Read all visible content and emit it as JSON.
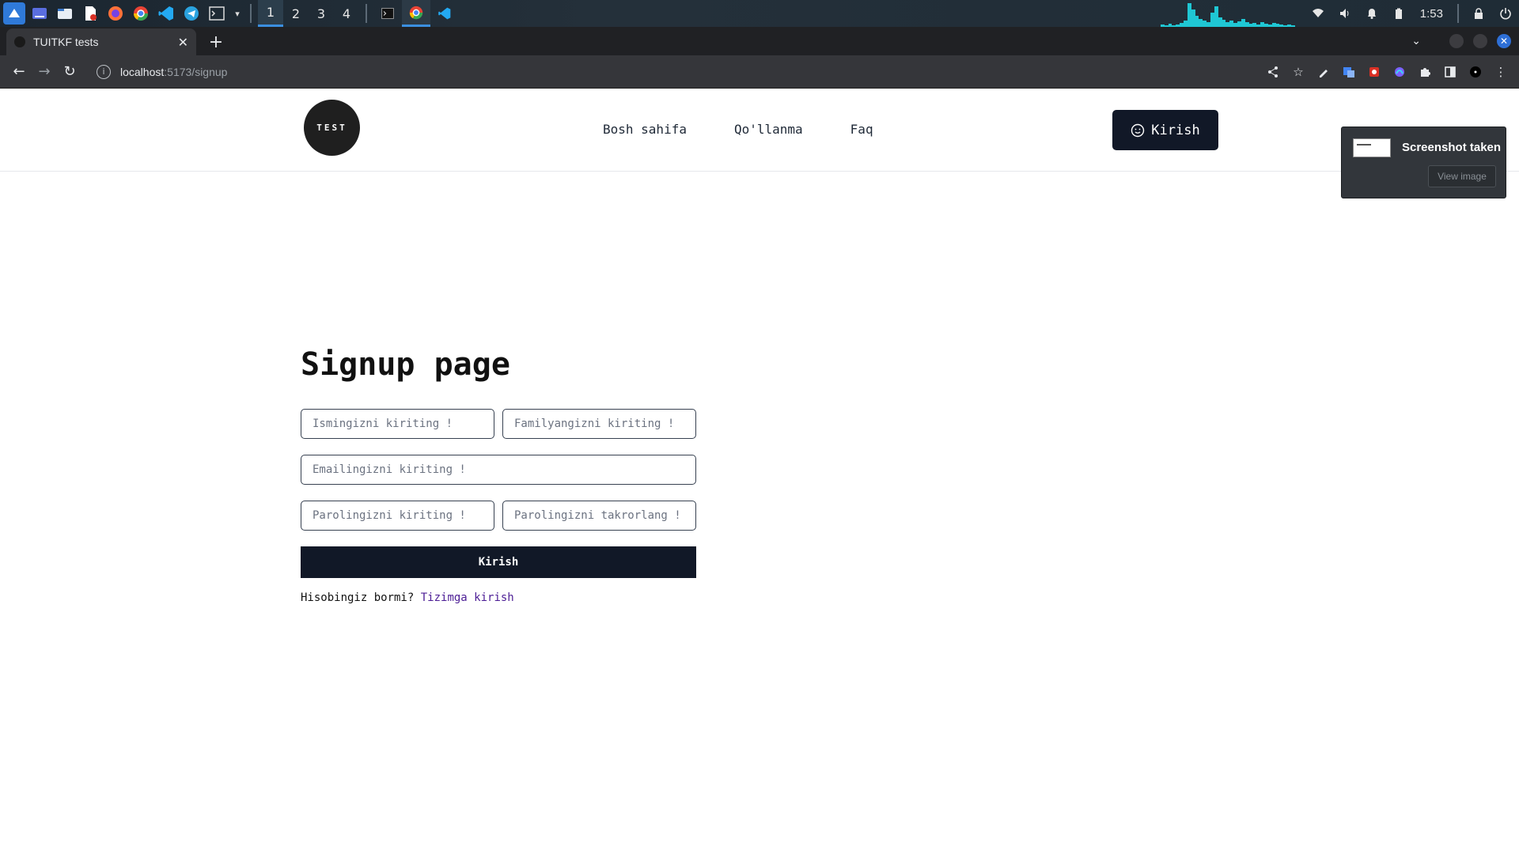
{
  "taskbar": {
    "apps": [
      {
        "icon": "launcher-icon",
        "color": "#2f7ad9"
      },
      {
        "icon": "desktop-icon",
        "color": "#5a6ee0"
      },
      {
        "icon": "files-icon",
        "color": "#e8eef5"
      },
      {
        "icon": "document-icon",
        "color": "#ffffff"
      },
      {
        "icon": "firefox-icon",
        "color": "#ff7139"
      },
      {
        "icon": "chrome-icon",
        "color": "#34a853"
      },
      {
        "icon": "vscode-icon",
        "color": "#23a9f2"
      },
      {
        "icon": "telegram-icon",
        "color": "#2aa3e0"
      },
      {
        "icon": "terminal-icon",
        "color": "#dcdcdc"
      }
    ],
    "workspaces": [
      "1",
      "2",
      "3",
      "4"
    ],
    "active_workspace": "1",
    "clock": "1:53"
  },
  "browser": {
    "tab_title": "TUITKF tests",
    "url_host": "localhost",
    "url_path": ":5173/signup"
  },
  "site": {
    "logo_text": "TEST",
    "nav": [
      "Bosh sahifa",
      "Qo'llanma",
      "Faq"
    ],
    "login_button": "Kirish"
  },
  "form": {
    "heading": "Signup page",
    "first_name_placeholder": "Ismingizni kiriting !",
    "last_name_placeholder": "Familyangizni kiriting !",
    "email_placeholder": "Emailingizni kiriting !",
    "password_placeholder": "Parolingizni kiriting !",
    "password_repeat_placeholder": "Parolingizni takrorlang !",
    "submit_label": "Kirish",
    "have_account_text": "Hisobingiz bormi?",
    "signin_link": "Tizimga kirish"
  },
  "notification": {
    "title": "Screenshot taken",
    "button": "View image"
  },
  "colors": {
    "primary": "#111827",
    "link": "#4c1d95",
    "accent": "#3b8fe0"
  }
}
